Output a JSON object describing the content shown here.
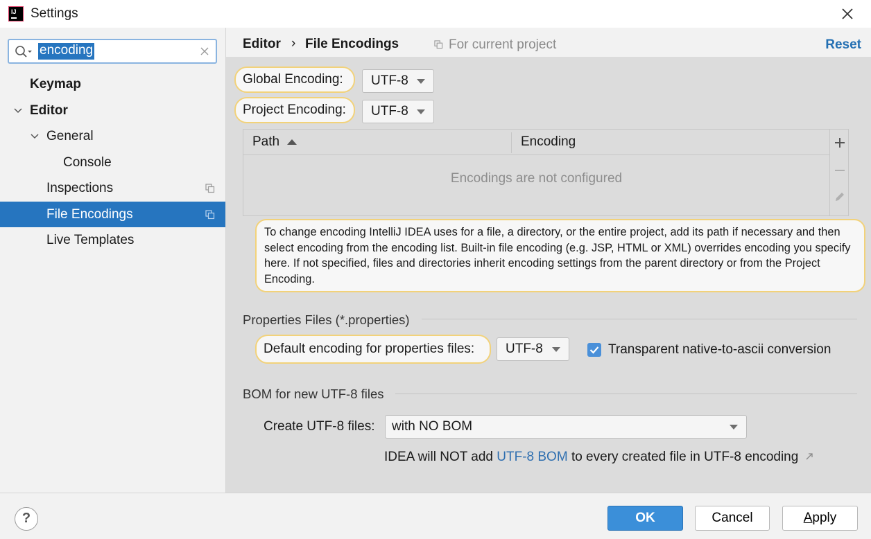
{
  "window": {
    "title": "Settings",
    "app_icon_text": "IJ"
  },
  "search": {
    "value": "encoding"
  },
  "sidebar": {
    "items": [
      {
        "label": "Keymap"
      },
      {
        "label": "Editor"
      },
      {
        "label": "General"
      },
      {
        "label": "Console"
      },
      {
        "label": "Inspections"
      },
      {
        "label": "File Encodings"
      },
      {
        "label": "Live Templates"
      }
    ]
  },
  "breadcrumb": {
    "parent": "Editor",
    "separator": "›",
    "current": "File Encodings",
    "scope": "For current project",
    "reset": "Reset"
  },
  "encodings": {
    "global_label": "Global Encoding:",
    "global_value": "UTF-8",
    "project_label": "Project Encoding:",
    "project_value": "UTF-8"
  },
  "table": {
    "col_path": "Path",
    "col_encoding": "Encoding",
    "empty_message": "Encodings are not configured"
  },
  "tooltip": {
    "text": "To change encoding IntelliJ IDEA uses for a file, a directory, or the entire project, add its path if necessary and then select encoding from the encoding list. Built-in file encoding (e.g. JSP, HTML or XML) overrides encoding you specify here. If not specified, files and directories inherit encoding settings from the parent directory or from the Project Encoding."
  },
  "properties": {
    "section_title": "Properties Files (*.properties)",
    "default_label": "Default encoding for properties files:",
    "default_value": "UTF-8",
    "checkbox_label": "Transparent native-to-ascii conversion",
    "checkbox_checked": true
  },
  "bom": {
    "section_title": "BOM for new UTF-8 files",
    "create_label": "Create UTF-8 files:",
    "create_value": "with NO BOM",
    "note_prefix": "IDEA will NOT add",
    "note_link": "UTF-8 BOM",
    "note_suffix": "to every created file in UTF-8 encoding"
  },
  "footer": {
    "help": "?",
    "ok": "OK",
    "cancel": "Cancel",
    "apply": "Apply"
  },
  "colors": {
    "accent": "#2675bf",
    "highlight_border": "#f2d27a",
    "link": "#2470b3"
  }
}
